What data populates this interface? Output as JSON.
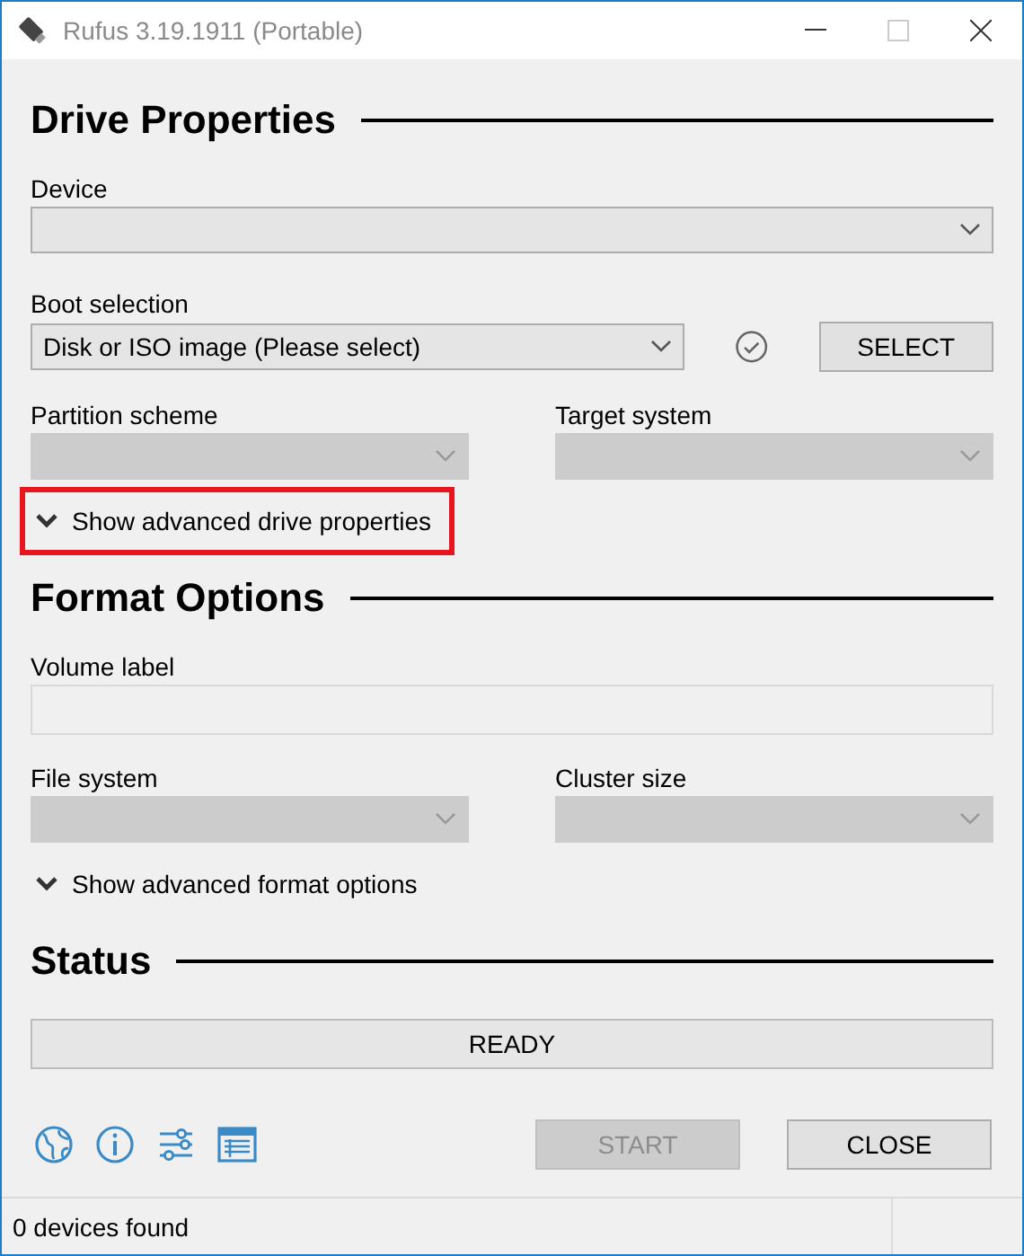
{
  "window": {
    "title": "Rufus 3.19.1911 (Portable)"
  },
  "sections": [
    {
      "title": "Drive Properties",
      "rows": [
        {
          "kind": "select",
          "label": "Device",
          "disabled": false
        },
        {
          "kind": "select_button",
          "label": "Boot selection",
          "value": "Disk or ISO image (Please select)",
          "disabled": false,
          "button": "SELECT"
        },
        {
          "kind": "pair",
          "fields": [
            {
              "label": "Partition scheme",
              "disabled": true
            },
            {
              "label": "Target system",
              "disabled": true
            }
          ]
        },
        {
          "kind": "toggle",
          "label": "Show advanced drive properties",
          "expanded": false,
          "highlighted": true
        }
      ]
    },
    {
      "title": "Format Options",
      "rows": [
        {
          "kind": "text",
          "label": "Volume label",
          "disabled": true
        },
        {
          "kind": "pair",
          "fields": [
            {
              "label": "File system",
              "disabled": true
            },
            {
              "label": "Cluster size",
              "disabled": true
            }
          ]
        },
        {
          "kind": "toggle",
          "label": "Show advanced format options",
          "expanded": false,
          "highlighted": false
        }
      ]
    },
    {
      "title": "Status",
      "rows": [
        {
          "kind": "progress",
          "label": "READY",
          "level": 0
        }
      ]
    }
  ],
  "actions": [
    {
      "label": "START",
      "disabled": true
    },
    {
      "label": "CLOSE",
      "disabled": false
    }
  ],
  "status_bar": {
    "text": "0 devices found"
  }
}
